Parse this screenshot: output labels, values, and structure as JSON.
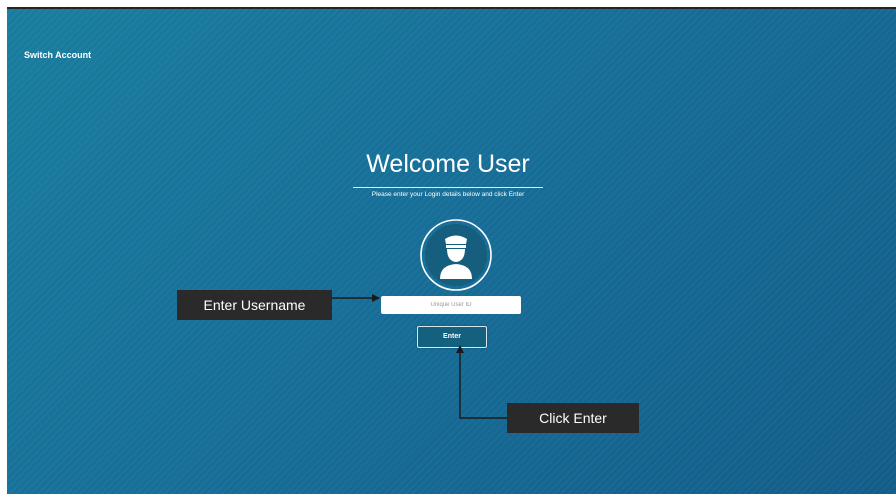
{
  "header": {
    "switch_account_label": "Switch Account"
  },
  "login": {
    "title": "Welcome User",
    "subtitle": "Please enter your Login details below and click Enter",
    "username_placeholder": "Unique User ID",
    "username_value": "",
    "enter_button_label": "Enter",
    "avatar_icon": "user-captain-icon"
  },
  "annotations": {
    "username_callout": "Enter Username",
    "enter_callout": "Click Enter"
  },
  "colors": {
    "background": "#17709a",
    "callout_bg": "#2a2a2a",
    "avatar_circle": "#155e7e"
  }
}
